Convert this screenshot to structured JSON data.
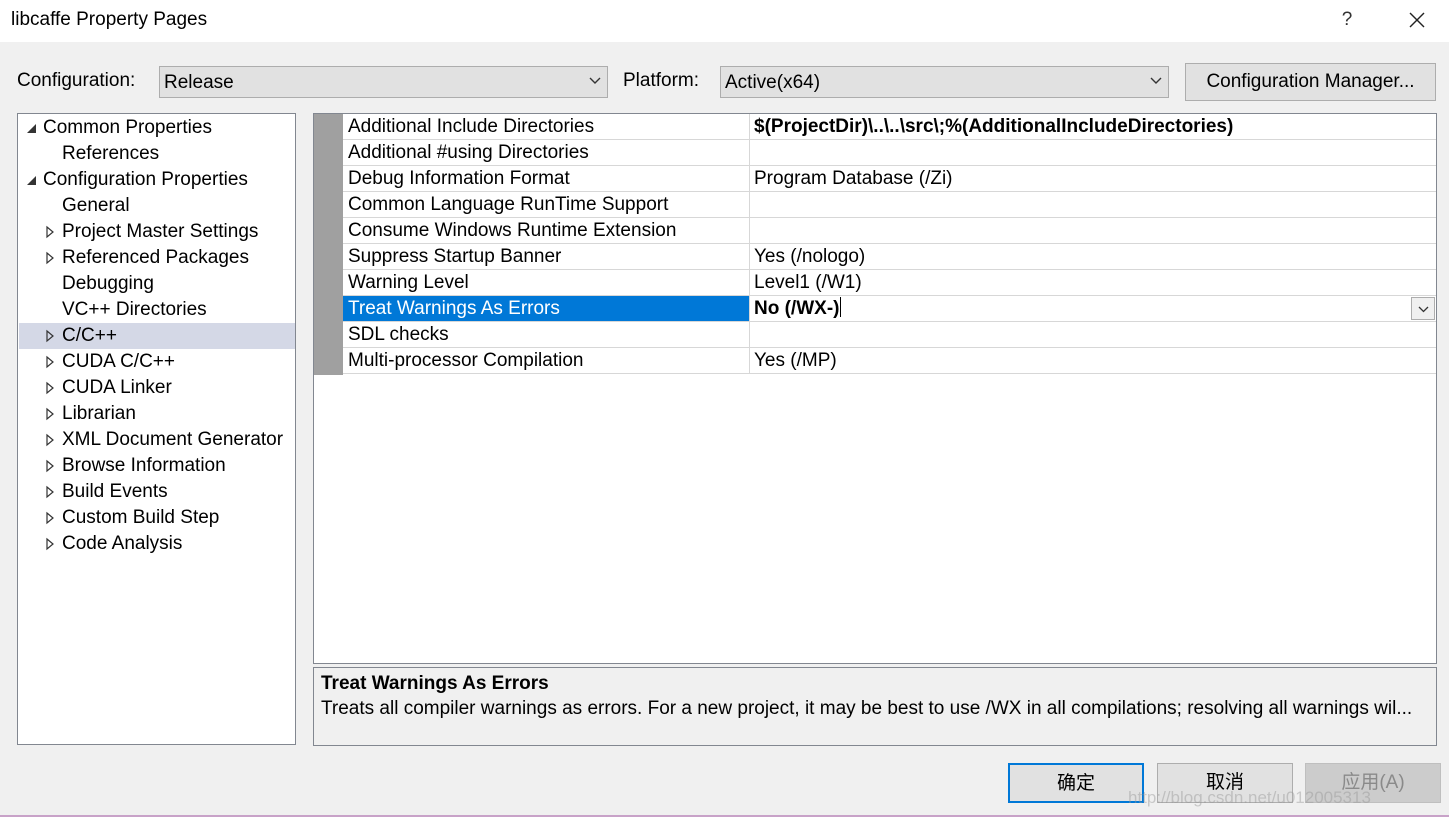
{
  "window": {
    "title": "libcaffe Property Pages",
    "help_label": "?"
  },
  "toolbar": {
    "configuration_label": "Configuration:",
    "configuration_value": "Release",
    "platform_label": "Platform:",
    "platform_value": "Active(x64)",
    "config_manager_label": "Configuration Manager..."
  },
  "tree": [
    {
      "label": "Common Properties",
      "expander": "expanded"
    },
    {
      "label": "References",
      "expander": "none"
    },
    {
      "label": "Configuration Properties",
      "expander": "expanded"
    },
    {
      "label": "General",
      "expander": "none"
    },
    {
      "label": "Project Master Settings",
      "expander": "collapsed"
    },
    {
      "label": "Referenced Packages",
      "expander": "collapsed"
    },
    {
      "label": "Debugging",
      "expander": "none"
    },
    {
      "label": "VC++ Directories",
      "expander": "none"
    },
    {
      "label": "C/C++",
      "expander": "collapsed",
      "selected": true
    },
    {
      "label": "CUDA C/C++",
      "expander": "collapsed"
    },
    {
      "label": "CUDA Linker",
      "expander": "collapsed"
    },
    {
      "label": "Librarian",
      "expander": "collapsed"
    },
    {
      "label": "XML Document Generator",
      "expander": "collapsed"
    },
    {
      "label": "Browse Information",
      "expander": "collapsed"
    },
    {
      "label": "Build Events",
      "expander": "collapsed"
    },
    {
      "label": "Custom Build Step",
      "expander": "collapsed"
    },
    {
      "label": "Code Analysis",
      "expander": "collapsed"
    }
  ],
  "properties": [
    {
      "name": "Additional Include Directories",
      "value": "$(ProjectDir)\\..\\..\\src\\;%(AdditionalIncludeDirectories)",
      "bold": true
    },
    {
      "name": "Additional #using Directories",
      "value": ""
    },
    {
      "name": "Debug Information Format",
      "value": "Program Database (/Zi)"
    },
    {
      "name": "Common Language RunTime Support",
      "value": ""
    },
    {
      "name": "Consume Windows Runtime Extension",
      "value": ""
    },
    {
      "name": "Suppress Startup Banner",
      "value": "Yes (/nologo)"
    },
    {
      "name": "Warning Level",
      "value": "Level1 (/W1)"
    },
    {
      "name": "Treat Warnings As Errors",
      "value": "No (/WX-)",
      "bold": true,
      "selected": true,
      "editing": true
    },
    {
      "name": "SDL checks",
      "value": ""
    },
    {
      "name": "Multi-processor Compilation",
      "value": "Yes (/MP)"
    }
  ],
  "description": {
    "title": "Treat Warnings As Errors",
    "text": "Treats all compiler warnings as errors. For a new project, it may be best to use /WX in all compilations; resolving all warnings wil..."
  },
  "buttons": {
    "ok": "确定",
    "cancel": "取消",
    "apply": "应用(A)"
  },
  "watermark": "http://blog.csdn.net/u012005313",
  "colors": {
    "selection": "#0078d7",
    "tree_selection": "#d4d8e6",
    "gutter": "#a0a0a0"
  }
}
